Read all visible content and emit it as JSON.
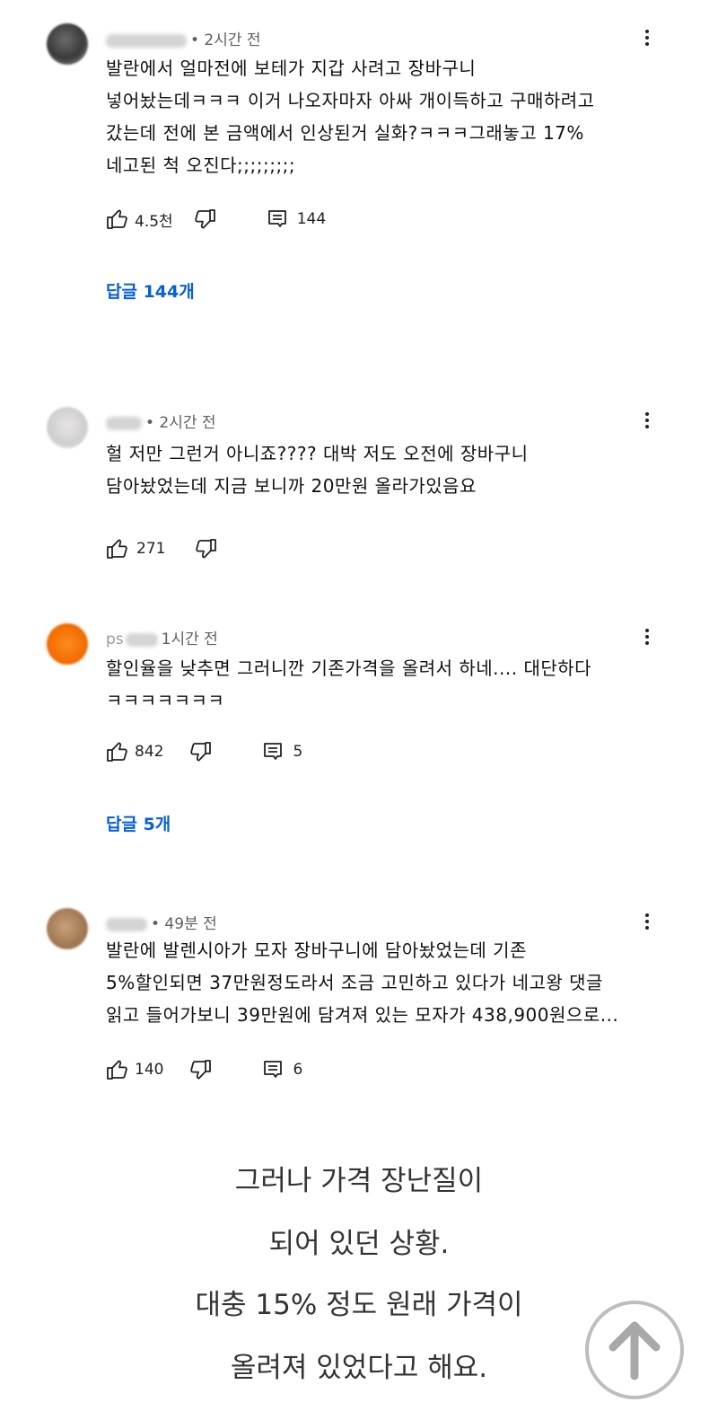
{
  "comments": [
    {
      "time": "• 2시간 전",
      "text": "발란에서 얼마전에 보테가 지갑 사려고 장바구니\n넣어놨는데ㅋㅋㅋ 이거 나오자마자 아싸 개이득하고 구매하려고\n갔는데 전에 본 금액에서 인상된거 실화?ㅋㅋㅋ그래놓고 17%\n네고된 척 오진다;;;;;;;;;",
      "likes": "4.5천",
      "reply_count": "144",
      "replies_link": "답글 144개"
    },
    {
      "time": "• 2시간 전",
      "text": "헐 저만 그런거 아니죠???? 대박 저도 오전에 장바구니\n담아놨었는데 지금 보니까 20만원 올라가있음요",
      "likes": "271"
    },
    {
      "author_partial": "ps",
      "time": "1시간 전",
      "text": "할인율을 낮추면 그러니깐 기존가격을 올려서 하네.... 대단하다\nㅋㅋㅋㅋㅋㅋㅋ",
      "likes": "842",
      "reply_count": "5",
      "replies_link": "답글 5개"
    },
    {
      "time": "• 49분 전",
      "text": "발란에 발렌시아가 모자 장바구니에 담아놨었는데 기존\n5%할인되면 37만원정도라서 조금 고민하고 있다가 네고왕 댓글\n읽고 들어가보니 39만원에 담겨져 있는 모자가 438,900원으로...",
      "likes": "140",
      "reply_count": "6"
    }
  ],
  "caption": {
    "line1": "그러나 가격 장난질이",
    "line2": "되어 있던 상황.",
    "line3": "대충 15% 정도 원래 가격이",
    "line4": "올려져 있었다고 해요."
  },
  "colors": {
    "link": "#065fd4",
    "meta": "#606060",
    "caption": "#333333"
  },
  "icons": {
    "like": "thumbs-up-icon",
    "dislike": "thumbs-down-icon",
    "reply": "reply-comment-icon",
    "more": "more-vert-icon",
    "scroll_top": "arrow-up-icon"
  }
}
